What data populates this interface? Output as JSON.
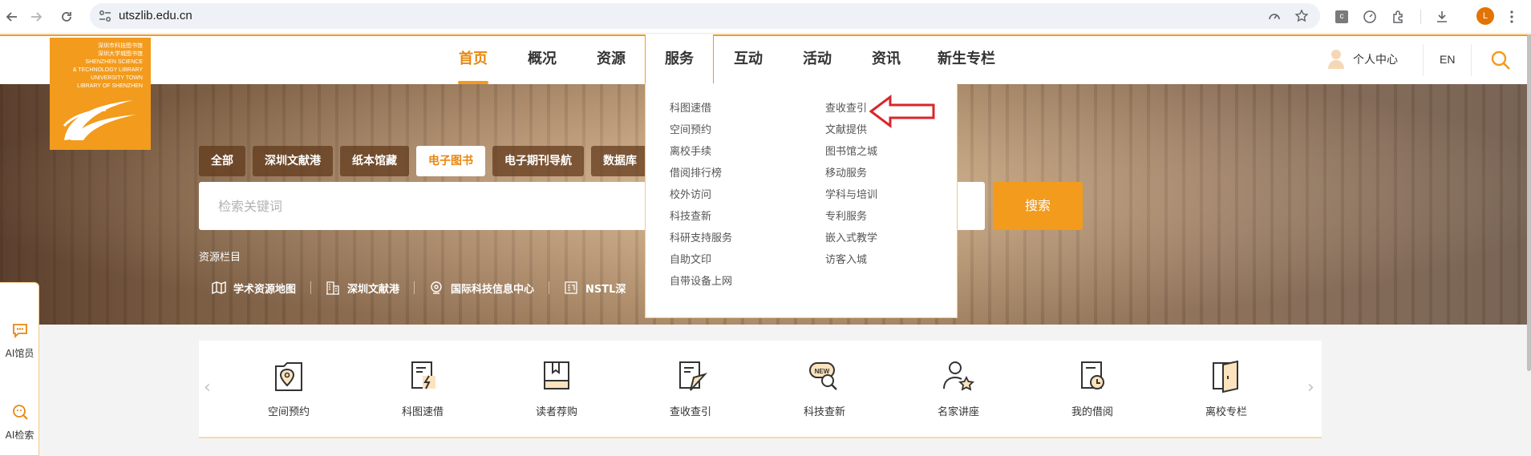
{
  "browser": {
    "url": "utszlib.edu.cn",
    "profile_initial": "L",
    "extension_badge": "c"
  },
  "header": {
    "logo_lines": [
      "深圳市科技图书馆",
      "深圳大学城图书馆",
      "SHENZHEN SCIENCE",
      "& TECHNOLOGY LIBRARY",
      "UNIVERSITY TOWN",
      "LIBRARY OF SHENZHEN"
    ],
    "nav": [
      {
        "label": "首页",
        "active": true
      },
      {
        "label": "概况"
      },
      {
        "label": "资源"
      },
      {
        "label": "服务",
        "open": true
      },
      {
        "label": "互动"
      },
      {
        "label": "活动"
      },
      {
        "label": "资讯"
      },
      {
        "label": "新生专栏"
      }
    ],
    "user_center": "个人中心",
    "language": "EN"
  },
  "banner": {
    "tabs": [
      "全部",
      "深圳文献港",
      "纸本馆藏",
      "电子图书",
      "电子期刊导航",
      "数据库"
    ],
    "active_tab": "电子图书",
    "search_placeholder": "检索关键词",
    "search_button": "搜索",
    "resources_title": "资源栏目",
    "resources": [
      "学术资源地图",
      "深圳文献港",
      "国际科技信息中心",
      "NSTL深"
    ]
  },
  "services_menu": {
    "left": [
      "科图速借",
      "空间预约",
      "离校手续",
      "借阅排行榜",
      "校外访问",
      "科技查新",
      "科研支持服务",
      "自助文印",
      "自带设备上网"
    ],
    "right": [
      "查收查引",
      "文献提供",
      "图书馆之城",
      "移动服务",
      "学科与培训",
      "专利服务",
      "嵌入式教学",
      "访客入城"
    ]
  },
  "side_panel": {
    "items": [
      "AI馆员",
      "AI检索"
    ]
  },
  "quick_services": {
    "prev": "‹",
    "next": "›",
    "items": [
      {
        "label": "空间预约",
        "icon": "space-booking-icon"
      },
      {
        "label": "科图速借",
        "icon": "quick-borrow-icon"
      },
      {
        "label": "读者荐购",
        "icon": "recommend-book-icon"
      },
      {
        "label": "查收查引",
        "icon": "citation-search-icon"
      },
      {
        "label": "科技查新",
        "icon": "novelty-search-icon"
      },
      {
        "label": "名家讲座",
        "icon": "lecture-icon"
      },
      {
        "label": "我的借阅",
        "icon": "my-borrow-icon"
      },
      {
        "label": "离校专栏",
        "icon": "leave-school-icon"
      }
    ]
  },
  "colors": {
    "accent": "#f29b1d",
    "accent_text": "#e8870e",
    "arrow": "#d9262c"
  }
}
